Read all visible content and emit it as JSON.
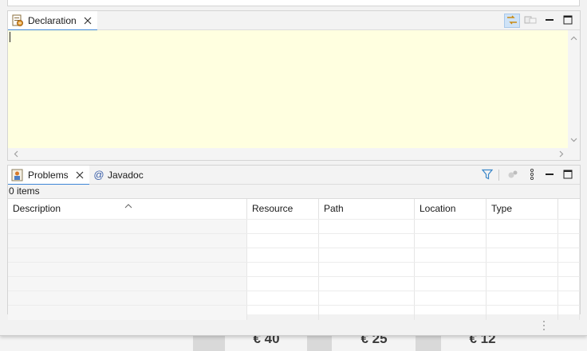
{
  "window": {
    "declaration_tab": {
      "label": "Declaration",
      "icon": "declaration-view-icon"
    },
    "declaration_toolbar": {
      "link_icon": "link-with-editor-icon",
      "open_input_icon": "open-input-icon",
      "minimize_icon": "minimize-icon",
      "maximize_icon": "maximize-icon"
    },
    "problems_tabs": [
      {
        "label": "Problems",
        "icon": "problems-icon"
      },
      {
        "label": "Javadoc",
        "icon": "at-sign-icon",
        "glyph": "@"
      }
    ],
    "problems_toolbar": {
      "filter_icon": "filter-icon",
      "configure_icon": "configure-contents-icon",
      "menu_icon": "view-menu-icon"
    },
    "problems": {
      "count_text": "0 items",
      "columns": [
        "Description",
        "Resource",
        "Path",
        "Location",
        "Type"
      ]
    }
  },
  "background": {
    "prices": [
      "€ 40",
      "€ 25",
      "€ 12"
    ]
  },
  "colors": {
    "declaration_background": "#ffffe0",
    "active_tab_underline": "#3d86d6",
    "toggle_active": "#cfe3f7"
  }
}
